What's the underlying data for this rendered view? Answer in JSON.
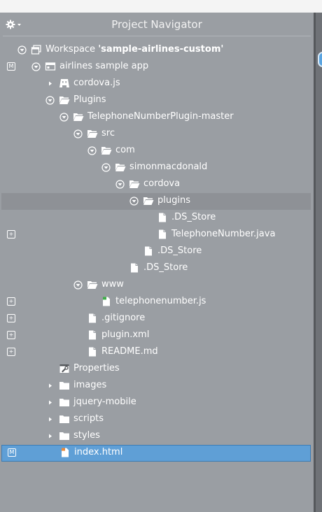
{
  "panel": {
    "title": "Project Navigator"
  },
  "workspace": {
    "prefix": "Workspace ",
    "name": "'sample-airlines-custom'"
  },
  "tree": [
    {
      "label": "airlines sample app",
      "badge": "M"
    },
    {
      "label": "cordova.js"
    },
    {
      "label": "Plugins"
    },
    {
      "label": "TelephoneNumberPlugin-master"
    },
    {
      "label": "src"
    },
    {
      "label": "com"
    },
    {
      "label": "simonmacdonald"
    },
    {
      "label": "cordova"
    },
    {
      "label": "plugins"
    },
    {
      "label": ".DS_Store"
    },
    {
      "label": "TelephoneNumber.java",
      "badge": "+"
    },
    {
      "label": ".DS_Store"
    },
    {
      "label": ".DS_Store"
    },
    {
      "label": "www"
    },
    {
      "label": "telephonenumber.js",
      "badge": "+"
    },
    {
      "label": ".gitignore",
      "badge": "+"
    },
    {
      "label": "plugin.xml",
      "badge": "+"
    },
    {
      "label": "README.md",
      "badge": "+"
    },
    {
      "label": "Properties"
    },
    {
      "label": "images"
    },
    {
      "label": "jquery-mobile"
    },
    {
      "label": "scripts"
    },
    {
      "label": "styles"
    },
    {
      "label": "index.html",
      "badge": "M"
    }
  ]
}
